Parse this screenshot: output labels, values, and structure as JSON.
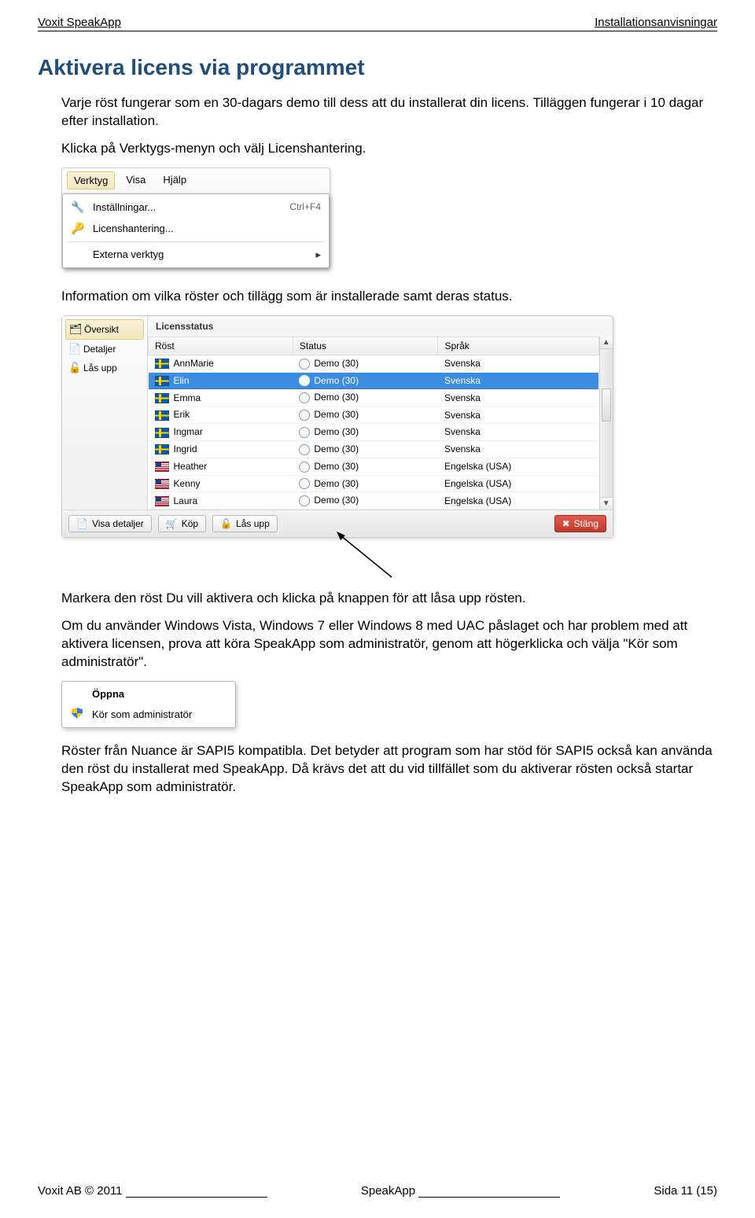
{
  "header": {
    "left": "Voxit SpeakApp",
    "right": "Installationsanvisningar"
  },
  "title": "Aktivera licens via programmet",
  "para1": "Varje röst fungerar som en 30-dagars demo till dess att du installerat din licens. Tilläggen fungerar i 10 dagar efter installation.",
  "para2": "Klicka på Verktygs-menyn och välj Licenshantering.",
  "menu": {
    "tabs": {
      "verktyg": "Verktyg",
      "visa": "Visa",
      "hjalp": "Hjälp"
    },
    "items": {
      "installningar": "Inställningar...",
      "installningar_shortcut": "Ctrl+F4",
      "licenshantering": "Licenshantering...",
      "externa": "Externa verktyg"
    }
  },
  "para3": "Information om vilka röster och tillägg som är installerade samt deras status.",
  "license": {
    "sidebar": {
      "oversikt": "Översikt",
      "detaljer": "Detaljer",
      "lasupp": "Lås upp"
    },
    "title": "Licensstatus",
    "headers": {
      "rost": "Röst",
      "status": "Status",
      "sprak": "Språk"
    },
    "rows": [
      {
        "flag": "se",
        "name": "AnnMarie",
        "status": "Demo (30)",
        "lang": "Svenska",
        "selected": false
      },
      {
        "flag": "se",
        "name": "Elin",
        "status": "Demo (30)",
        "lang": "Svenska",
        "selected": true
      },
      {
        "flag": "se",
        "name": "Emma",
        "status": "Demo (30)",
        "lang": "Svenska",
        "selected": false
      },
      {
        "flag": "se",
        "name": "Erik",
        "status": "Demo (30)",
        "lang": "Svenska",
        "selected": false
      },
      {
        "flag": "se",
        "name": "Ingmar",
        "status": "Demo (30)",
        "lang": "Svenska",
        "selected": false
      },
      {
        "flag": "se",
        "name": "Ingrid",
        "status": "Demo (30)",
        "lang": "Svenska",
        "selected": false
      },
      {
        "flag": "us",
        "name": "Heather",
        "status": "Demo (30)",
        "lang": "Engelska (USA)",
        "selected": false
      },
      {
        "flag": "us",
        "name": "Kenny",
        "status": "Demo (30)",
        "lang": "Engelska (USA)",
        "selected": false
      },
      {
        "flag": "us",
        "name": "Laura",
        "status": "Demo (30)",
        "lang": "Engelska (USA)",
        "selected": false
      }
    ],
    "footer": {
      "visa": "Visa detaljer",
      "kop": "Köp",
      "lasupp": "Lås upp",
      "stang": "Stäng"
    }
  },
  "para4": "Markera den röst Du vill aktivera och klicka på knappen för att låsa upp rösten.",
  "para5": "Om du använder Windows Vista, Windows 7 eller Windows 8 med UAC påslaget och har problem med att aktivera licensen, prova att köra SpeakApp som administratör, genom att högerklicka och välja \"Kör som administratör\".",
  "context": {
    "open": "Öppna",
    "runadmin": "Kör som administratör"
  },
  "para6": "Röster från Nuance är SAPI5 kompatibla. Det betyder att program som har stöd för SAPI5 också kan använda den röst du installerat med SpeakApp. Då krävs det att du vid tillfället som du aktiverar rösten också startar SpeakApp som administratör.",
  "footer": {
    "left": "Voxit AB © 2011",
    "center": "SpeakApp",
    "right": "Sida 11 (15)"
  }
}
